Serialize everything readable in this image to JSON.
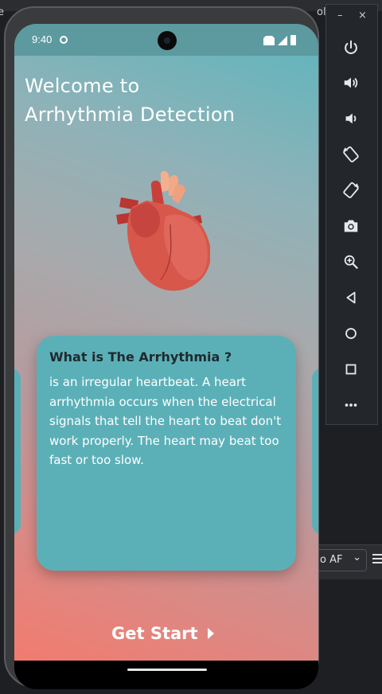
{
  "ide": {
    "left_fragment": "e",
    "right_fragment": "ol",
    "dropdown_value": "o AF"
  },
  "status_bar": {
    "time": "9:40"
  },
  "app": {
    "title_line1": "Welcome to",
    "title_line2": "Arrhythmia Detection",
    "card_title": "What is The Arrhythmia ?",
    "card_body": "is an irregular heartbeat. A heart arrhythmia occurs when the electrical signals that tell the heart to beat don't work properly. The heart may beat too fast or too slow.",
    "cta_label": "Get Start"
  },
  "emulator_toolbar": {
    "minimize_label": "–",
    "close_label": "×",
    "buttons": [
      "power-icon",
      "volume-up-icon",
      "volume-down-icon",
      "rotate-left-icon",
      "rotate-right-icon",
      "camera-icon",
      "zoom-icon",
      "back-icon",
      "home-icon",
      "overview-icon",
      "more-icon"
    ]
  },
  "colors": {
    "accent_teal": "#5bb0b8",
    "gradient_bottom": "#f27b6f",
    "heart_red": "#d7574a"
  }
}
